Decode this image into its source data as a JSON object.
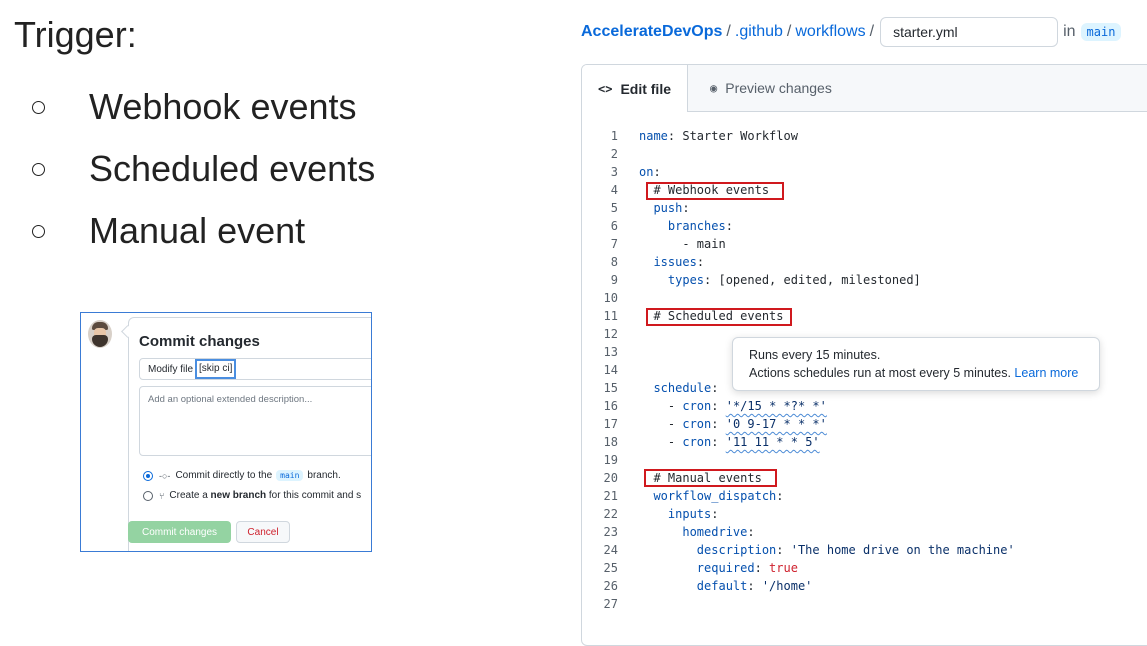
{
  "slide": {
    "title": "Trigger:",
    "bullets": [
      "Webhook events",
      "Scheduled events",
      "Manual event"
    ]
  },
  "commit_dialog": {
    "title": "Commit changes",
    "message_prefix": "Modify file",
    "message_highlight": "[skip ci]",
    "description_placeholder": "Add an optional extended description...",
    "option_direct": {
      "prefix": "Commit directly to the",
      "branch": "main",
      "suffix": "branch."
    },
    "option_new": {
      "prefix": "Create a",
      "bold": "new branch",
      "suffix": "for this commit and s"
    },
    "commit_button": "Commit changes",
    "cancel_button": "Cancel"
  },
  "breadcrumb": {
    "repo": "AccelerateDevOps",
    "dir1": ".github",
    "dir2": "workflows",
    "separator": "/",
    "filename": "starter.yml",
    "in_label": "in",
    "branch": "main"
  },
  "editor_tabs": {
    "edit": {
      "icon": "<>",
      "label": "Edit file"
    },
    "preview": {
      "icon": "◉",
      "label": "Preview changes"
    }
  },
  "tooltip": {
    "line1": "Runs every 15 minutes.",
    "line2": "Actions schedules run at most every 5 minutes.",
    "link": "Learn more"
  },
  "code_lines": [
    {
      "n": "1",
      "html": "<span class='k'>name</span>: Starter Workflow"
    },
    {
      "n": "2",
      "html": ""
    },
    {
      "n": "3",
      "html": "<span class='k'>on</span>:"
    },
    {
      "n": "4",
      "html": "  # Webhook events"
    },
    {
      "n": "5",
      "html": "  <span class='k'>push</span>:"
    },
    {
      "n": "6",
      "html": "    <span class='k'>branches</span>:"
    },
    {
      "n": "7",
      "html": "      - main"
    },
    {
      "n": "8",
      "html": "  <span class='k'>issues</span>:"
    },
    {
      "n": "9",
      "html": "    <span class='k'>types</span>: [opened, edited, milestoned]"
    },
    {
      "n": "10",
      "html": ""
    },
    {
      "n": "11",
      "html": "  # Scheduled events"
    },
    {
      "n": "12",
      "html": ""
    },
    {
      "n": "13",
      "html": ""
    },
    {
      "n": "14",
      "html": ""
    },
    {
      "n": "15",
      "html": "  <span class='k'>schedule</span>:"
    },
    {
      "n": "16",
      "html": "    - <span class='k'>cron</span>: <span class='s squig'>'*/15 * *?* *'</span>"
    },
    {
      "n": "17",
      "html": "    - <span class='k'>cron</span>: <span class='s squig'>'0 9-17 * * *'</span>"
    },
    {
      "n": "18",
      "html": "    - <span class='k'>cron</span>: <span class='s squig'>'11 11 * * 5'</span>"
    },
    {
      "n": "19",
      "html": ""
    },
    {
      "n": "20",
      "html": "  # Manual events"
    },
    {
      "n": "21",
      "html": "  <span class='k'>workflow_dispatch</span>:"
    },
    {
      "n": "22",
      "html": "    <span class='k'>inputs</span>:"
    },
    {
      "n": "23",
      "html": "      <span class='k'>homedrive</span>:"
    },
    {
      "n": "24",
      "html": "        <span class='k'>description</span>: <span class='s'>'The home drive on the machine'</span>"
    },
    {
      "n": "25",
      "html": "        <span class='k'>required</span>: <span class='b'>true</span>"
    },
    {
      "n": "26",
      "html": "        <span class='k'>default</span>: <span class='s'>'/home'</span>"
    },
    {
      "n": "27",
      "html": ""
    }
  ]
}
